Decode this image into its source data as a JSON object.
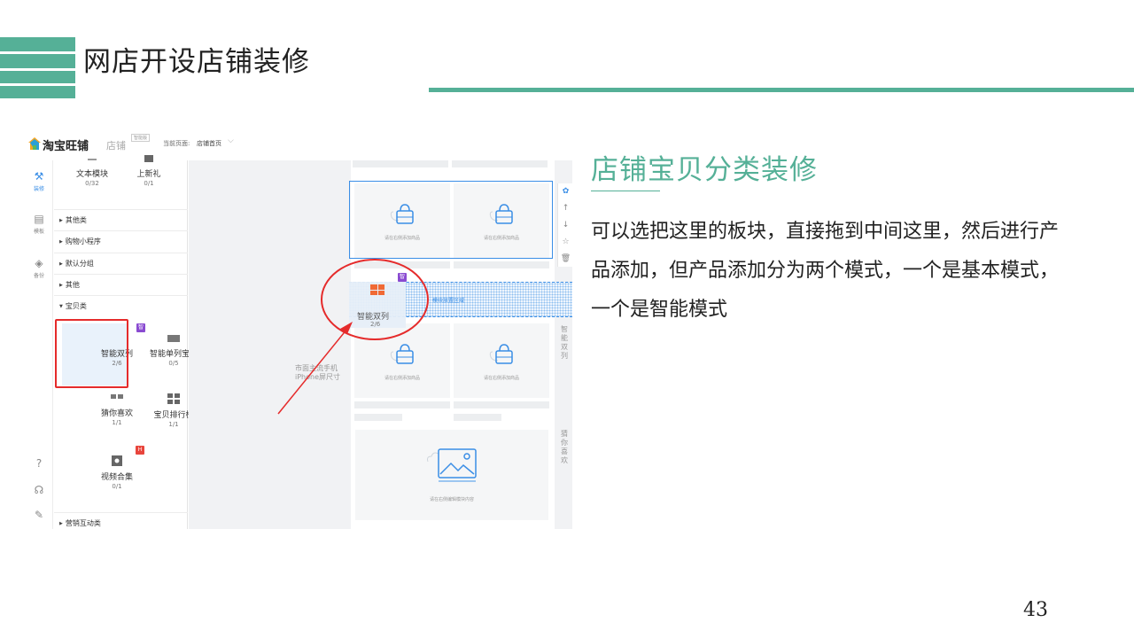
{
  "slide": {
    "title": "网店开设店铺装修",
    "section_title": "店铺宝贝分类装修",
    "body": " 可以选把这里的板块，直接拖到中间这里，然后进行产品添加，但产品添加分为两个模式，一个是基本模式，一个是智能模式",
    "page_number": "43",
    "accent_color": "#55b097"
  },
  "screenshot": {
    "brand": "淘宝旺铺",
    "brand_sub": "店铺",
    "version_badge": "智能版",
    "current_page_label": "当前页面:",
    "current_page_value": "店铺首页",
    "left_nav": [
      {
        "label": "装修",
        "icon": "hammer-icon",
        "active": true
      },
      {
        "label": "模板",
        "icon": "template-icon",
        "active": false
      },
      {
        "label": "备份",
        "icon": "layers-icon",
        "active": false
      }
    ],
    "bottom_icons": [
      "help-icon",
      "headset-icon",
      "edit-icon"
    ],
    "modules_top": [
      {
        "label": "文本模块",
        "count": "0/32"
      },
      {
        "label": "上新礼",
        "count": "0/1"
      }
    ],
    "categories": [
      {
        "label": "其他类"
      },
      {
        "label": "购物小程序"
      },
      {
        "label": "默认分组"
      },
      {
        "label": "其他"
      },
      {
        "label": "宝贝类"
      }
    ],
    "modules_baby": [
      {
        "label": "智能双列",
        "count": "2/6",
        "badge": "智"
      },
      {
        "label": "智能单列宝贝",
        "count": "0/5",
        "badge": "智"
      },
      {
        "label": "猜你喜欢",
        "count": "1/1"
      },
      {
        "label": "宝贝排行榜",
        "count": "1/1"
      },
      {
        "label": "视频合集",
        "count": "0/1",
        "badge": "H"
      }
    ],
    "footer_category": "营销互动类",
    "canvas_hint_line1": "市面主流手机",
    "canvas_hint_line2": "iPhone屏尺寸",
    "placeholder_caption": "请在右侧添加商品",
    "image_caption": "请在右侧编辑模块内容",
    "drop_zone_label": "模块放置区域",
    "drag_ghost_label": "智能双列",
    "drag_ghost_count": "2/6",
    "drag_ghost_badge": "智",
    "side_labels": [
      "智能双列",
      "猜你喜欢"
    ],
    "toolbar_icons": [
      "gear-icon",
      "arrow-up-icon",
      "arrow-down-icon",
      "star-icon",
      "trash-icon"
    ]
  }
}
